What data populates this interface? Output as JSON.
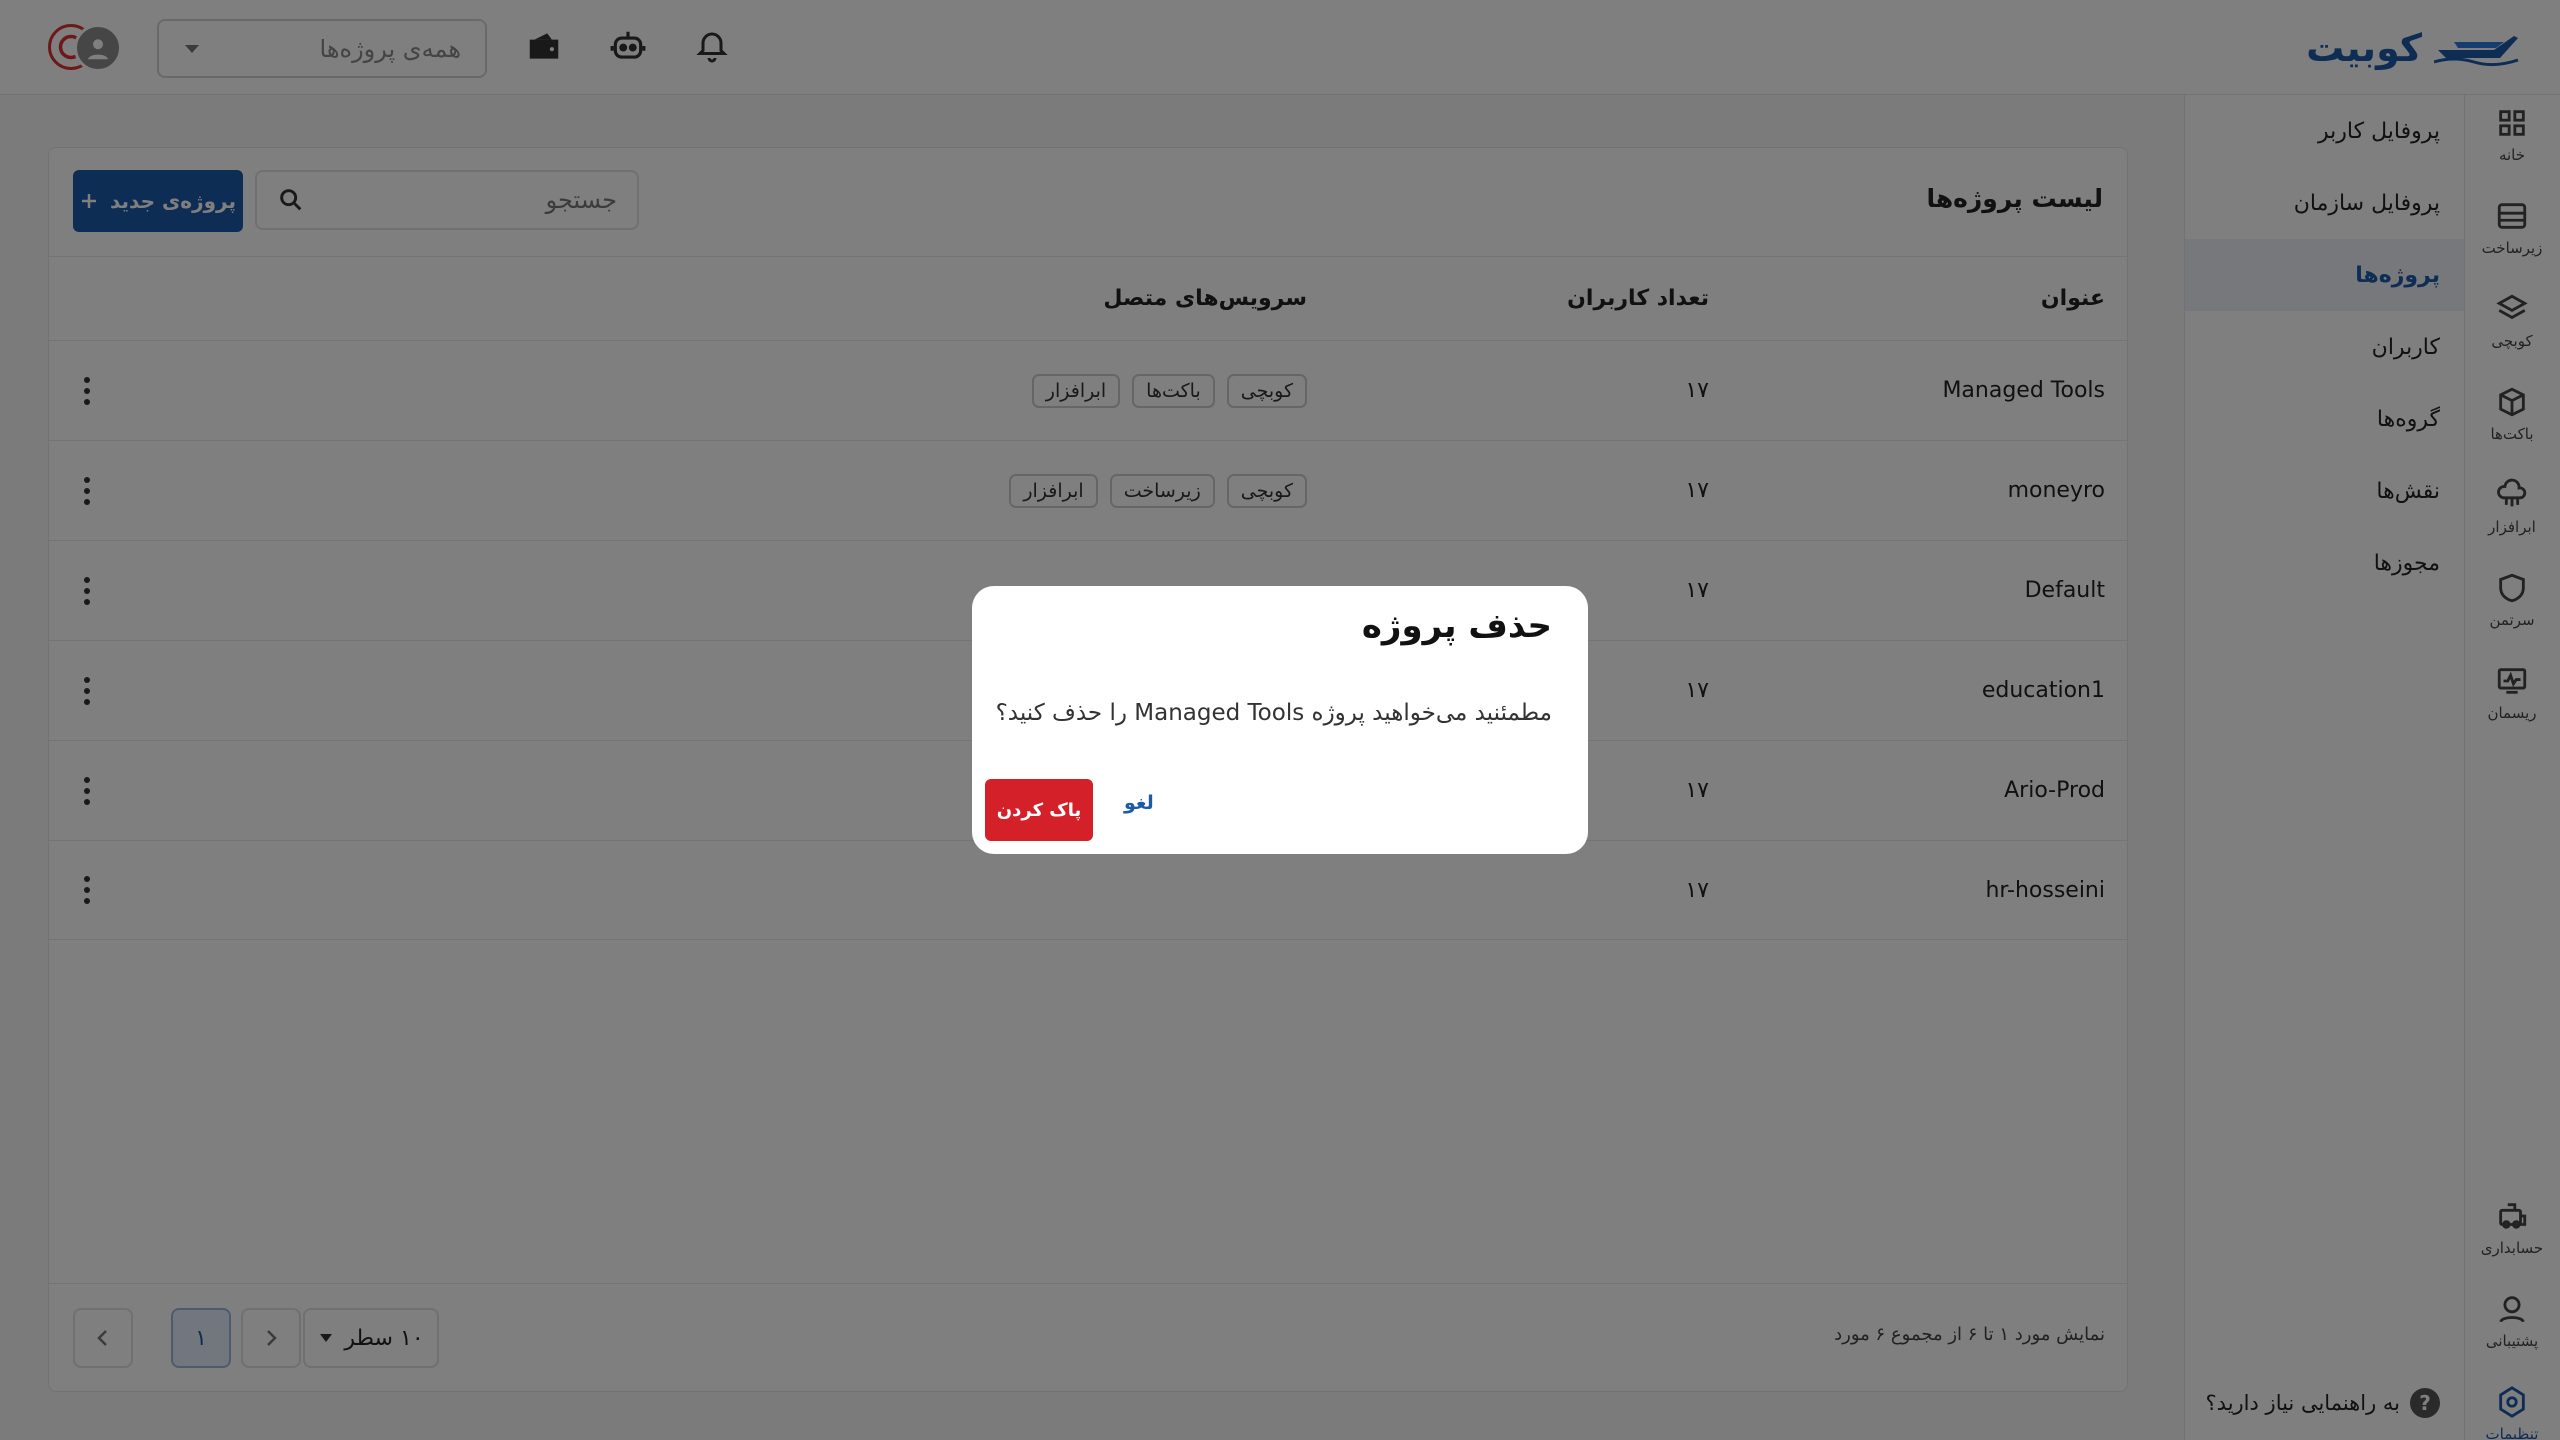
{
  "header": {
    "logo_text": "کوبیت",
    "project_select": {
      "placeholder": "همه‌ی پروژه‌ها"
    },
    "icons": [
      "notification-bell-icon",
      "robot-icon",
      "wallet-icon"
    ]
  },
  "rail": {
    "items": [
      {
        "label": "خانه",
        "icon": "grid-icon"
      },
      {
        "label": "زیرساخت",
        "icon": "server-icon"
      },
      {
        "label": "کوبچی",
        "icon": "layers-icon"
      },
      {
        "label": "باکت‌ها",
        "icon": "box-icon"
      },
      {
        "label": "ابرافزار",
        "icon": "cloud-app-icon"
      },
      {
        "label": "سرتمن",
        "icon": "shield-icon"
      },
      {
        "label": "ریسمان",
        "icon": "monitor-chart-icon"
      },
      {
        "label": "حسابداری",
        "icon": "accounting-icon"
      },
      {
        "label": "پشتیبانی",
        "icon": "support-icon"
      },
      {
        "label": "تنظیمات",
        "icon": "settings-icon"
      }
    ]
  },
  "submenu": {
    "items": [
      {
        "label": "پروفایل کاربر"
      },
      {
        "label": "پروفایل سازمان"
      },
      {
        "label": "پروژه‌ها",
        "active": true
      },
      {
        "label": "کاربران"
      },
      {
        "label": "گروه‌ها"
      },
      {
        "label": "نقش‌ها"
      },
      {
        "label": "مجوزها"
      }
    ],
    "help_text": "به راهنمایی نیاز دارید؟",
    "help_symbol": "?"
  },
  "projects": {
    "title": "لیست پروژه‌ها",
    "search_placeholder": "جستجو",
    "new_button": "پروژه‌ی جدید",
    "columns": {
      "title": "عنوان",
      "users": "تعداد کاربران",
      "services": "سرویس‌های متصل"
    },
    "rows": [
      {
        "title": "Managed Tools",
        "users": "۱۷",
        "services": [
          "کوبچی",
          "باکت‌ها",
          "ابرافزار"
        ]
      },
      {
        "title": "moneyro",
        "users": "۱۷",
        "services": [
          "کوبچی",
          "زیرساخت",
          "ابرافزار"
        ]
      },
      {
        "title": "Default",
        "users": "۱۷",
        "services": []
      },
      {
        "title": "education1",
        "users": "۱۷",
        "services": []
      },
      {
        "title": "Ario-Prod",
        "users": "۱۷",
        "services": []
      },
      {
        "title": "hr-hosseini",
        "users": "۱۷",
        "services": []
      }
    ],
    "footer": {
      "range_text": "نمایش مورد ۱ تا ۶ از مجموع ۶ مورد",
      "rows_per_page": "۱۰ سطر",
      "current_page": "۱"
    }
  },
  "dialog": {
    "title": "حذف پروژه",
    "message": "مطمئنید می‌خواهید پروژه Managed Tools را حذف کنید؟",
    "delete_label": "پاک کردن",
    "cancel_label": "لغو"
  },
  "colors": {
    "primary": "#1d5aa8",
    "danger": "#d32029",
    "overlay": "rgba(0,0,0,0.5)"
  }
}
